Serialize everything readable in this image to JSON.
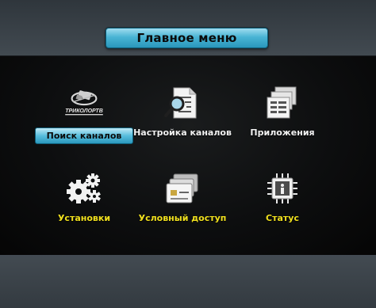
{
  "header": {
    "title": "Главное меню"
  },
  "menu": {
    "items": [
      {
        "label": "Поиск каналов",
        "icon": "tricolor-tv-logo-icon",
        "logo_text": "ТРИКОЛОРТВ",
        "selected": true
      },
      {
        "label": "Настройка каналов",
        "icon": "document-search-icon"
      },
      {
        "label": "Приложения",
        "icon": "stacked-documents-icon"
      },
      {
        "label": "Установки",
        "icon": "gears-icon"
      },
      {
        "label": "Условный доступ",
        "icon": "smart-card-icon"
      },
      {
        "label": "Статус",
        "icon": "chip-info-icon"
      }
    ]
  },
  "colors": {
    "accent": "#49b4d4",
    "label_yellow": "#f0e01e",
    "label_white": "#f2f2f2"
  }
}
